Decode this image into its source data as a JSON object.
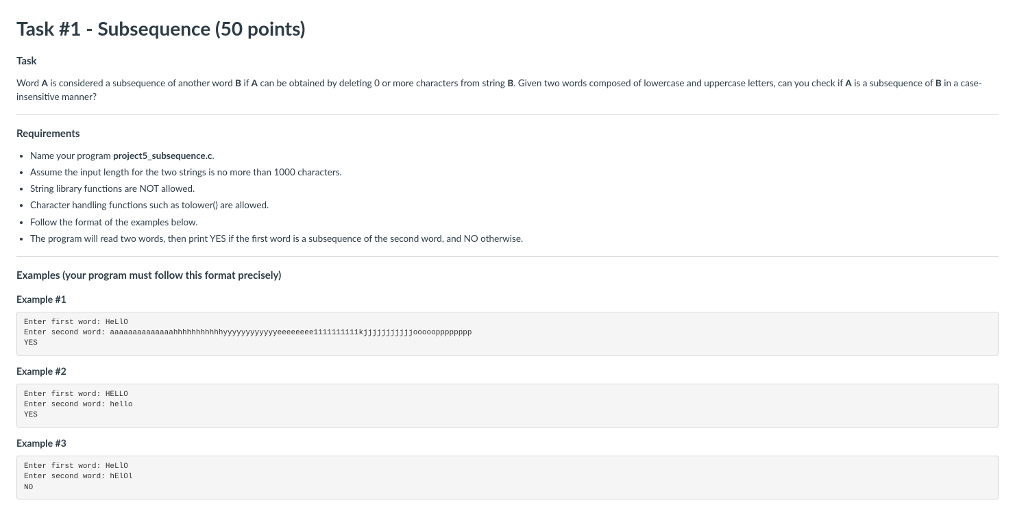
{
  "title": "Task #1 - Subsequence (50 points)",
  "task": {
    "heading": "Task",
    "para_parts": [
      "Word ",
      "A",
      " is considered a subsequence of another word ",
      "B",
      " if ",
      "A",
      " can be obtained by deleting 0 or more characters from string ",
      "B",
      ". Given two words composed of lowercase and uppercase letters, can you check if ",
      "A",
      " is a subsequence of ",
      "B",
      " in a case-insensitive manner?"
    ]
  },
  "requirements": {
    "heading": "Requirements",
    "items": [
      {
        "prefix": "Name your program ",
        "bold": "project5_subsequence.c",
        "suffix": "."
      },
      {
        "prefix": "Assume the input length for the two strings is no more than 1000 characters.",
        "bold": "",
        "suffix": ""
      },
      {
        "prefix": "String library functions are NOT allowed.",
        "bold": "",
        "suffix": ""
      },
      {
        "prefix": "Character handling functions such as tolower() are allowed.",
        "bold": "",
        "suffix": ""
      },
      {
        "prefix": "Follow the format of the examples below.",
        "bold": "",
        "suffix": ""
      },
      {
        "prefix": "The program will read two words, then print YES if the first word is a subsequence of the second word, and NO otherwise.",
        "bold": "",
        "suffix": ""
      }
    ]
  },
  "examples_heading": "Examples (your program must follow this format precisely)",
  "examples": [
    {
      "label": "Example #1",
      "output": "Enter first word: HeLlO\nEnter second word: aaaaaaaaaaaaaahhhhhhhhhhhyyyyyyyyyyyyeeeeeeee1111111111kjjjjjjjjjjjooooopppppppp\nYES"
    },
    {
      "label": "Example #2",
      "output": "Enter first word: HELLO\nEnter second word: hello\nYES"
    },
    {
      "label": "Example #3",
      "output": "Enter first word: HeLlO\nEnter second word: hElOl\nNO"
    }
  ]
}
